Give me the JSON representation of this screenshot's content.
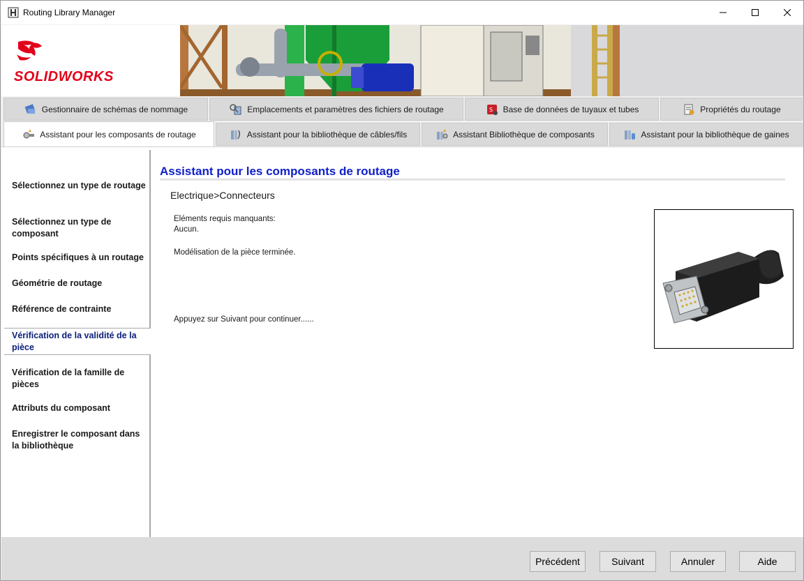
{
  "window": {
    "title": "Routing Library Manager",
    "minimize_icon": "minimize-icon",
    "maximize_icon": "maximize-icon",
    "close_icon": "close-icon"
  },
  "banner": {
    "logo_solid": "SOLID",
    "logo_works": "WORKS",
    "brand_color": "#e2001a"
  },
  "tabs_row1": [
    {
      "label": "Gestionnaire de schémas de nommage",
      "icon": "naming-schema-icon"
    },
    {
      "label": "Emplacements et paramètres des fichiers de routage",
      "icon": "file-locations-icon"
    },
    {
      "label": "Base de données de tuyaux et tubes",
      "icon": "pipe-database-icon"
    },
    {
      "label": "Propriétés du routage",
      "icon": "routing-properties-icon"
    }
  ],
  "tabs_row2": [
    {
      "label": "Assistant pour les composants de routage",
      "icon": "routing-component-wizard-icon",
      "active": true
    },
    {
      "label": "Assistant pour la bibliothèque de câbles/fils",
      "icon": "cable-library-icon"
    },
    {
      "label": "Assistant Bibliothèque de composants",
      "icon": "component-library-icon"
    },
    {
      "label": "Assistant pour la bibliothèque de gaines",
      "icon": "covering-library-icon"
    }
  ],
  "sidebar": {
    "steps": [
      "Sélectionnez un type de routage",
      "Sélectionnez un type de composant",
      "Points spécifiques à un routage",
      "Géométrie de routage",
      "Référence de contrainte",
      "Vérification de la validité de la pièce",
      "Vérification de la famille de pièces",
      "Attributs du composant",
      "Enregistrer le composant dans la bibliothèque"
    ],
    "active_index": 5
  },
  "main": {
    "title": "Assistant pour les composants de routage",
    "breadcrumb": "Electrique>Connecteurs",
    "missing_label": "Eléments requis manquants:",
    "missing_value": "Aucun.",
    "modeling_status": "Modélisation de la pièce terminée.",
    "continue_hint": "Appuyez sur Suivant pour continuer......",
    "preview_icon": "d-sub-connector-icon",
    "title_color": "#1020c8"
  },
  "footer": {
    "previous": "Précédent",
    "next": "Suivant",
    "cancel": "Annuler",
    "help": "Aide"
  }
}
